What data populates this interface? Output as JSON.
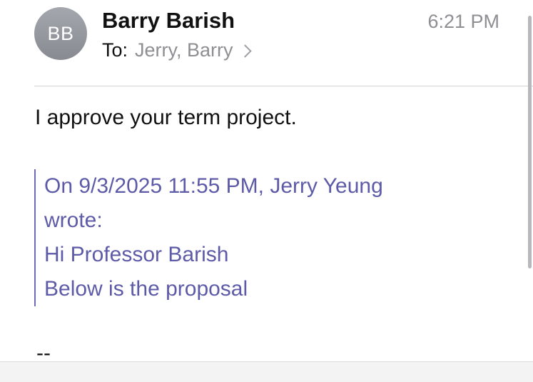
{
  "header": {
    "avatar_initials": "BB",
    "sender_name": "Barry Barish",
    "time": "6:21 PM",
    "to_label": "To:",
    "recipients": "Jerry, Barry"
  },
  "message": {
    "body": "I approve your term project.",
    "quoted": {
      "attribution_line1": "On 9/3/2025 11:55 PM, Jerry Yeung",
      "attribution_line2": "wrote:",
      "line1": "Hi Professor Barish",
      "line2": "Below is the proposal"
    },
    "signature_separator": "--"
  },
  "colors": {
    "quote_text": "#5d5aa8",
    "quote_bar": "#6f6bb8",
    "secondary_text": "#8e8e93"
  }
}
